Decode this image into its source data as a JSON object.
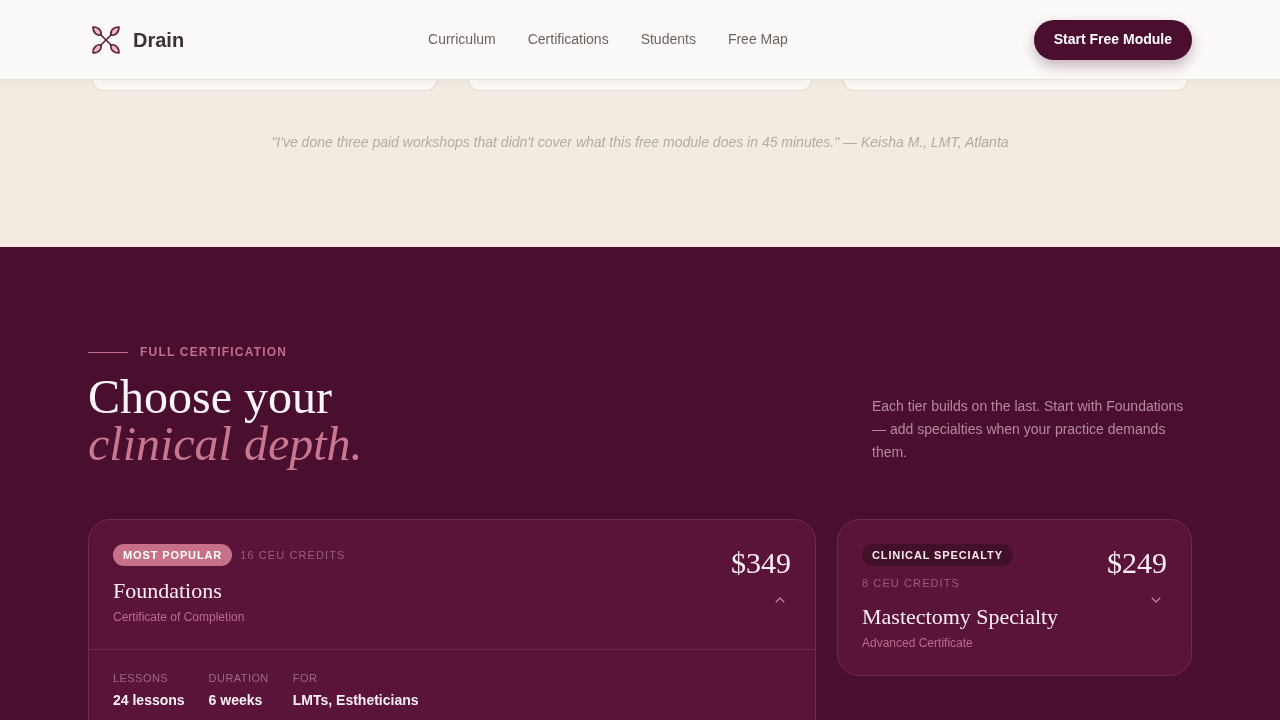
{
  "header": {
    "brand": "Drain",
    "nav": [
      {
        "label": "Curriculum"
      },
      {
        "label": "Certifications"
      },
      {
        "label": "Students"
      },
      {
        "label": "Free Map"
      }
    ],
    "cta": "Start Free Module"
  },
  "testimonial": {
    "quote": "\"I've done three paid workshops that didn't cover what this free module does in 45 minutes.\" — Keisha M., LMT, Atlanta"
  },
  "certification": {
    "eyebrow": "FULL CERTIFICATION",
    "title": "Choose your",
    "title_emphasis": "clinical depth.",
    "intro": "Each tier builds on the last. Start with Foundations — add specialties when your practice demands them.",
    "tiers": [
      {
        "badge": {
          "label": "MOST POPULAR",
          "kind": "accent"
        },
        "credits": "16 CEU CREDITS",
        "name": "Foundations",
        "subtitle": "Certificate of Completion",
        "price": "$349",
        "expanded": true,
        "details": [
          {
            "label": "LESSONS",
            "value": "24 lessons"
          },
          {
            "label": "DURATION",
            "value": "6 weeks"
          },
          {
            "label": "FOR",
            "value": "LMTs, Estheticians"
          }
        ]
      },
      {
        "badge": {
          "label": "CLINICAL SPECIALTY",
          "kind": "dark"
        },
        "credits": "8 CEU CREDITS",
        "name": "Mastectomy Specialty",
        "subtitle": "Advanced Certificate",
        "price": "$249",
        "expanded": false
      }
    ]
  }
}
